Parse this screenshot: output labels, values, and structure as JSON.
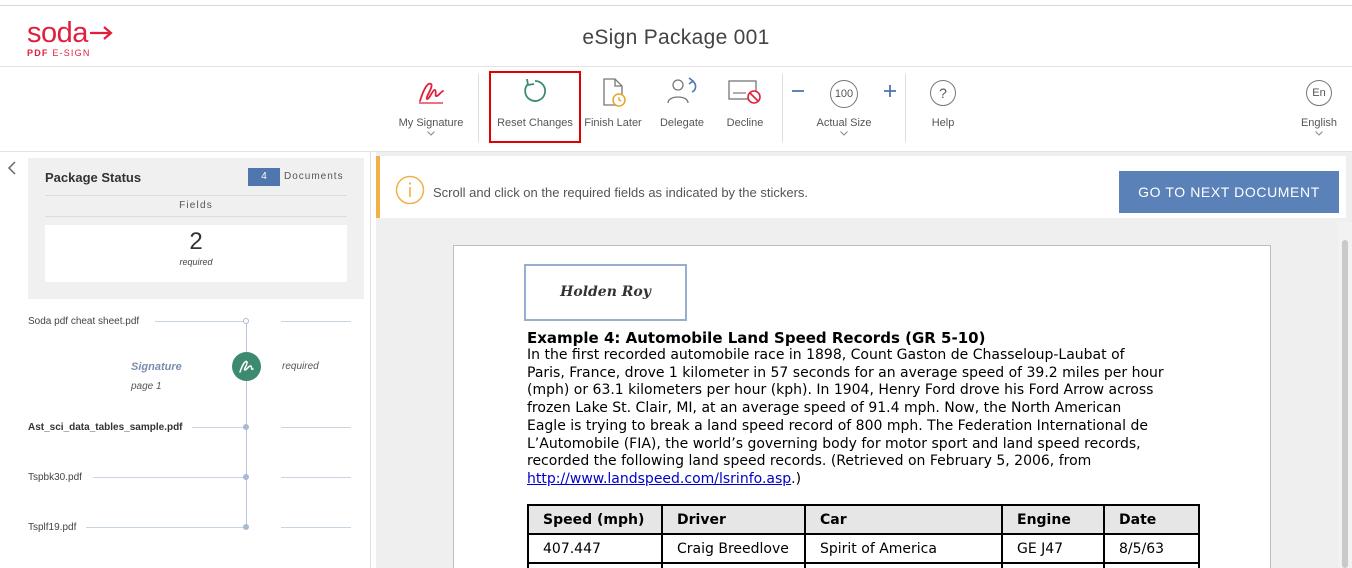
{
  "header": {
    "logo_main": "soda",
    "logo_sub_bold": "PDF",
    "logo_sub": "E-SIGN",
    "title": "eSign Package 001"
  },
  "toolbar": {
    "my_signature": "My Signature",
    "reset_changes": "Reset Changes",
    "finish_later": "Finish Later",
    "delegate": "Delegate",
    "decline": "Decline",
    "zoom_value": "100",
    "actual_size": "Actual Size",
    "help": "Help",
    "lang_code": "En",
    "language": "English"
  },
  "package": {
    "title": "Package Status",
    "document_count": "4",
    "documents_label": "Documents",
    "fields_label": "Fields",
    "fields_required_count": "2",
    "fields_required_label": "required"
  },
  "documents": [
    {
      "name": "Soda pdf cheat sheet.pdf"
    },
    {
      "name": "Ast_sci_data_tables_sample.pdf"
    },
    {
      "name": "Tspbk30.pdf"
    },
    {
      "name": "Tsplf19.pdf"
    }
  ],
  "signature_item": {
    "label": "Signature",
    "page": "page 1",
    "status": "required"
  },
  "notice": {
    "text": "Scroll and click on the required fields as indicated by the stickers.",
    "next_button": "GO TO NEXT DOCUMENT"
  },
  "document": {
    "signature_name": "Holden Roy",
    "heading": "Example 4: Automobile Land Speed Records (GR 5-10)",
    "lines": [
      "In the first recorded automobile race in 1898, Count Gaston de Chasseloup-Laubat of",
      "Paris, France, drove 1 kilometer in 57 seconds for an average speed of 39.2 miles per hour",
      "(mph) or 63.1 kilometers per hour (kph). In 1904, Henry Ford drove his Ford Arrow across",
      "frozen Lake St. Clair, MI, at an average speed of 91.4 mph. Now, the North American",
      "Eagle is trying to break a land speed record of 800 mph. The Federation International de",
      "L’Automobile (FIA), the world’s governing body for motor sport and land speed records,",
      "recorded the following land speed records. (Retrieved on February 5, 2006, from"
    ],
    "link": "http://www.landspeed.com/lsrinfo.asp",
    "link_suffix": ".)",
    "table": {
      "headers": [
        "Speed (mph)",
        "Driver",
        "Car",
        "Engine",
        "Date"
      ],
      "rows": [
        [
          "407.447",
          "Craig Breedlove",
          "Spirit of America",
          "GE J47",
          "8/5/63"
        ]
      ]
    }
  },
  "colors": {
    "brand": "#e11f3c",
    "accent_blue": "#5a82b8",
    "signature_green": "#3d8a70",
    "notice_orange": "#f2b04a",
    "highlight_red": "#e00000"
  }
}
